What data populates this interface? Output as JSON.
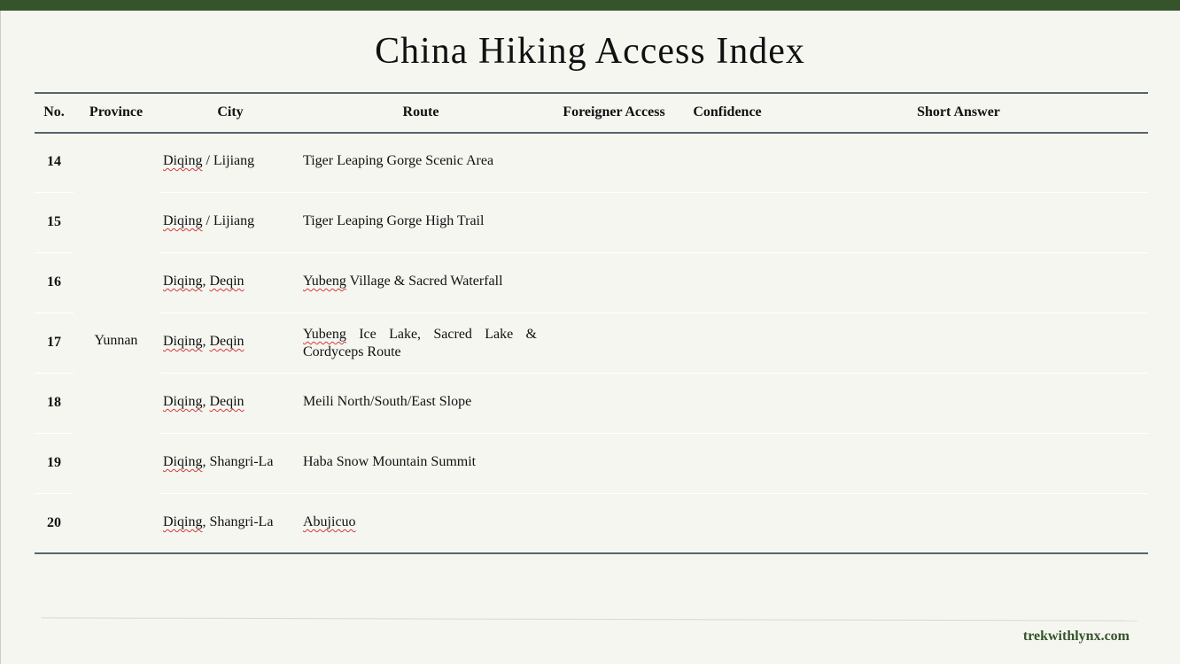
{
  "title": "China Hiking Access Index",
  "headers": {
    "no": "No.",
    "province": "Province",
    "city": "City",
    "route": "Route",
    "access": "Foreigner Access",
    "confidence": "Confidence",
    "answer": "Short Answer"
  },
  "province": "Yunnan",
  "rows": [
    {
      "no": "14",
      "city_a": "Diqing",
      "city_b": " / Lijiang",
      "route_a": "",
      "route_b": "Tiger Leaping Gorge Scenic Area"
    },
    {
      "no": "15",
      "city_a": "Diqing",
      "city_b": " / Lijiang",
      "route_a": "",
      "route_b": "Tiger Leaping Gorge High Trail"
    },
    {
      "no": "16",
      "city_a": "Diqing",
      "city_sep": ", ",
      "city_c": "Deqin",
      "route_a": "Yubeng",
      "route_b": " Village & Sacred Waterfall"
    },
    {
      "no": "17",
      "city_a": "Diqing",
      "city_sep": ", ",
      "city_c": "Deqin",
      "route_a": "Yubeng",
      "route_b": " Ice Lake, Sacred Lake & Cordyceps Route"
    },
    {
      "no": "18",
      "city_a": "Diqing",
      "city_sep": ", ",
      "city_c": "Deqin",
      "route_a": "",
      "route_b": "Meili North/South/East Slope"
    },
    {
      "no": "19",
      "city_a": "Diqing",
      "city_b": ", Shangri-La",
      "route_a": "",
      "route_b": "Haba Snow Mountain Summit"
    },
    {
      "no": "20",
      "city_a": "Diqing",
      "city_b": ", Shangri-La",
      "route_a": "Abujicuo",
      "route_b": ""
    }
  ],
  "footer": "trekwithlynx.com"
}
